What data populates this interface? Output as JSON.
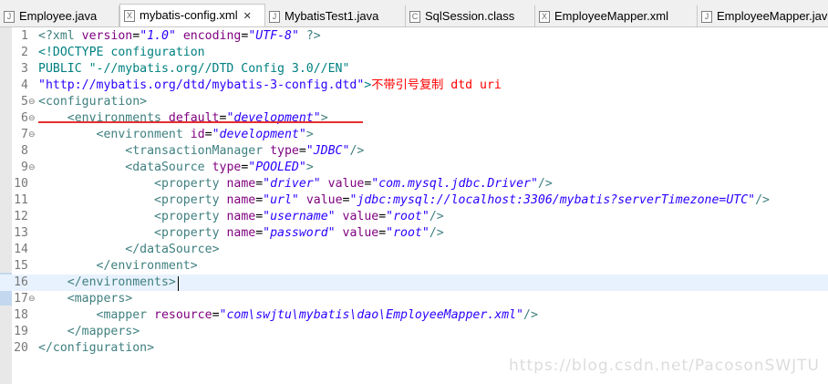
{
  "tabs": [
    {
      "label": "Employee.java",
      "icon": "J",
      "active": false
    },
    {
      "label": "mybatis-config.xml",
      "icon": "X",
      "active": true
    },
    {
      "label": "MybatisTest1.java",
      "icon": "J",
      "active": false
    },
    {
      "label": "SqlSession.class",
      "icon": "C",
      "active": false
    },
    {
      "label": "EmployeeMapper.xml",
      "icon": "X",
      "active": false
    },
    {
      "label": "EmployeeMapper.java",
      "icon": "J",
      "active": false
    }
  ],
  "editor": {
    "current_line": 16,
    "lines": [
      {
        "num": "1",
        "text": "<?xml version=\"1.0\" encoding=\"UTF-8\" ?>"
      },
      {
        "num": "2",
        "text": "<!DOCTYPE configuration"
      },
      {
        "num": "3",
        "text": "PUBLIC \"-//mybatis.org//DTD Config 3.0//EN\""
      },
      {
        "num": "4",
        "text": "\"http://mybatis.org/dtd/mybatis-3-config.dtd\">"
      },
      {
        "num": "5",
        "text": "<configuration>"
      },
      {
        "num": "6",
        "text": "    <environments default=\"development\">"
      },
      {
        "num": "7",
        "text": "        <environment id=\"development\">"
      },
      {
        "num": "8",
        "text": "            <transactionManager type=\"JDBC\"/>"
      },
      {
        "num": "9",
        "text": "            <dataSource type=\"POOLED\">"
      },
      {
        "num": "10",
        "text": "                <property name=\"driver\" value=\"com.mysql.jdbc.Driver\"/>"
      },
      {
        "num": "11",
        "text": "                <property name=\"url\" value=\"jdbc:mysql://localhost:3306/mybatis?serverTimezone=UTC\"/>"
      },
      {
        "num": "12",
        "text": "                <property name=\"username\" value=\"root\"/>"
      },
      {
        "num": "13",
        "text": "                <property name=\"password\" value=\"root\"/>"
      },
      {
        "num": "14",
        "text": "            </dataSource>"
      },
      {
        "num": "15",
        "text": "        </environment>"
      },
      {
        "num": "16",
        "text": "    </environments>"
      },
      {
        "num": "17",
        "text": "    <mappers>"
      },
      {
        "num": "18",
        "text": "        <mapper resource=\"com\\swjtu\\mybatis\\dao\\EmployeeMapper.xml\"/>"
      },
      {
        "num": "19",
        "text": "    </mappers>"
      },
      {
        "num": "20",
        "text": "</configuration>"
      }
    ],
    "annotation": {
      "cjk": "不带引号复制",
      "latin": " dtd uri"
    },
    "fold_lines": [
      "5",
      "6",
      "7",
      "9",
      "17"
    ]
  },
  "watermark": "https://blog.csdn.net/PacosonSWJTU",
  "colors": {
    "tag": "#3f7f7f",
    "attr": "#7f007f",
    "value": "#2a00ff",
    "note": "#ff0000",
    "current_line": "#e8f2fe"
  }
}
